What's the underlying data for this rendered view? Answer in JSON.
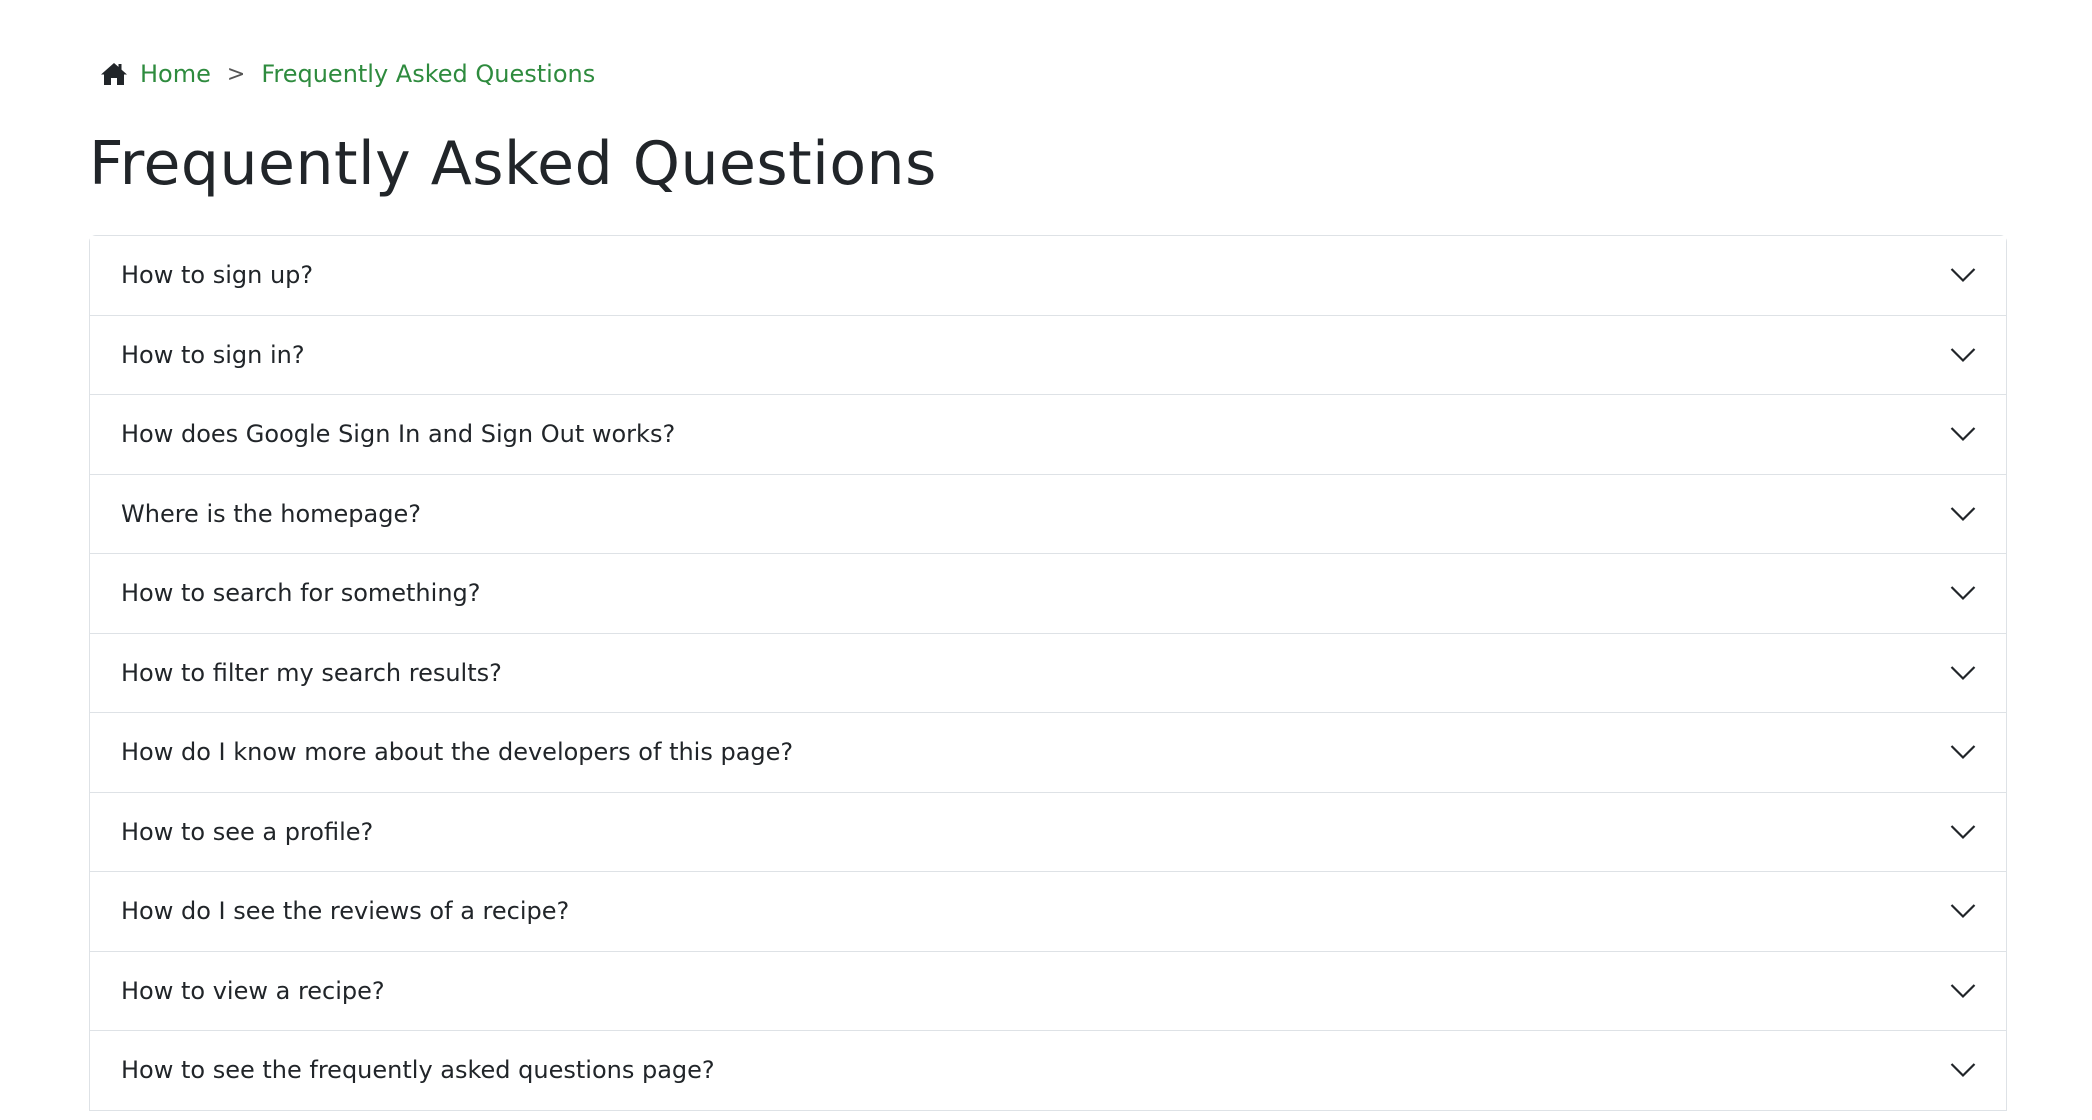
{
  "breadcrumb": {
    "home_label": "Home",
    "separator": ">",
    "current_label": "Frequently Asked Questions",
    "link_color": "#2e8b3e"
  },
  "page": {
    "title": "Frequently Asked Questions"
  },
  "faq": {
    "items": [
      {
        "question": "How to sign up?",
        "icon": "chevron-down-icon"
      },
      {
        "question": "How to sign in?",
        "icon": "chevron-down-icon"
      },
      {
        "question": "How does Google Sign In and Sign Out works?",
        "icon": "chevron-down-icon"
      },
      {
        "question": "Where is the homepage?",
        "icon": "chevron-down-icon"
      },
      {
        "question": "How to search for something?",
        "icon": "chevron-down-icon"
      },
      {
        "question": "How to filter my search results?",
        "icon": "chevron-down-icon"
      },
      {
        "question": "How do I know more about the developers of this page?",
        "icon": "chevron-down-icon"
      },
      {
        "question": "How to see a profile?",
        "icon": "chevron-down-icon"
      },
      {
        "question": "How do I see the reviews of a recipe?",
        "icon": "chevron-down-icon"
      },
      {
        "question": "How to view a recipe?",
        "icon": "chevron-down-icon"
      },
      {
        "question": "How to see the frequently asked questions page?",
        "icon": "chevron-down-icon"
      }
    ]
  }
}
